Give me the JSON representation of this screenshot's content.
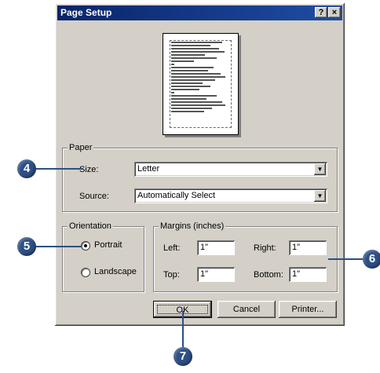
{
  "window": {
    "title": "Page Setup",
    "help_btn": "?",
    "close_btn": "×"
  },
  "paper": {
    "group_label": "Paper",
    "size_label": "Size:",
    "size_value": "Letter",
    "source_label": "Source:",
    "source_value": "Automatically Select"
  },
  "orientation": {
    "group_label": "Orientation",
    "portrait": "Portrait",
    "landscape": "Landscape",
    "selected": "Portrait"
  },
  "margins": {
    "group_label": "Margins (inches)",
    "left_label": "Left:",
    "left_value": "1\"",
    "right_label": "Right:",
    "right_value": "1\"",
    "top_label": "Top:",
    "top_value": "1\"",
    "bottom_label": "Bottom:",
    "bottom_value": "1\""
  },
  "buttons": {
    "ok": "OK",
    "cancel": "Cancel",
    "printer": "Printer..."
  },
  "callouts": {
    "c4": "4",
    "c5": "5",
    "c6": "6",
    "c7": "7"
  },
  "colors": {
    "callout": "#2e4f85",
    "titlebar": "#0a246a",
    "dialog": "#d4d0c8"
  }
}
